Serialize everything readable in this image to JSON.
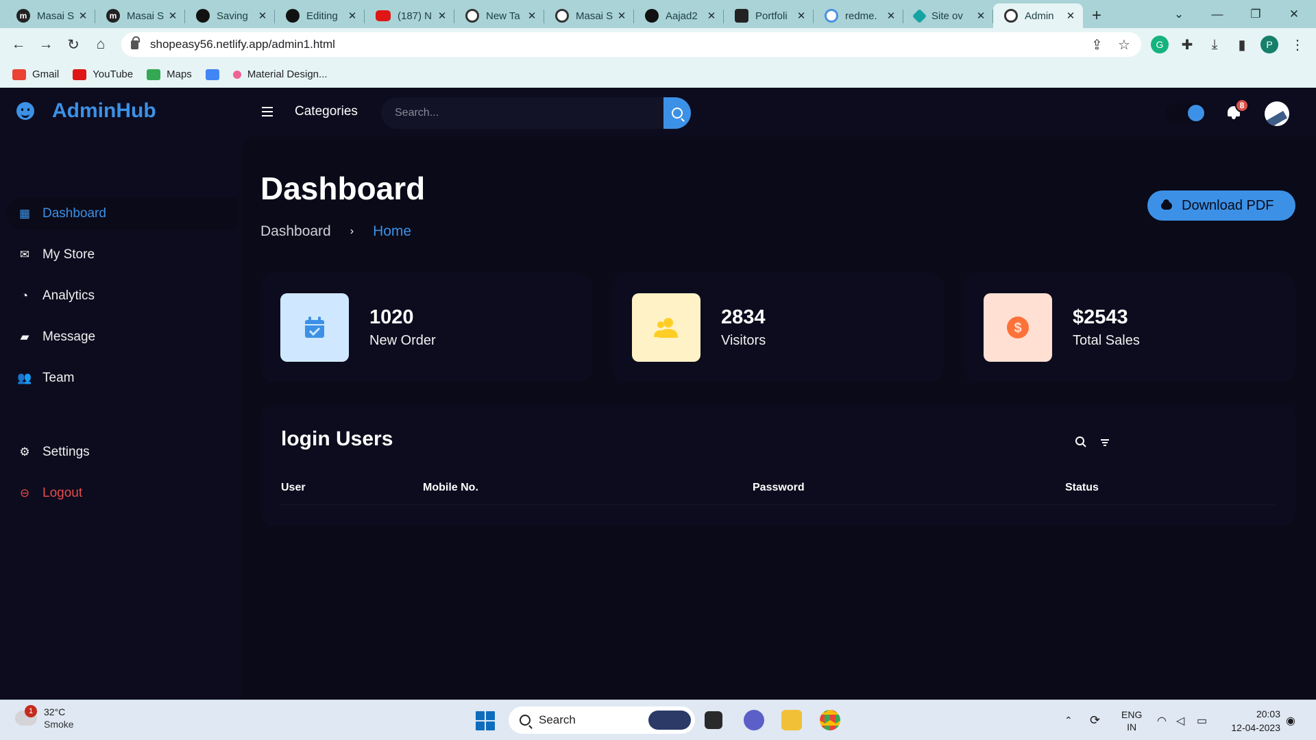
{
  "browser": {
    "tabs": [
      {
        "icon": "masai-favicon",
        "title": "Masai S",
        "active": false
      },
      {
        "icon": "masai-favicon",
        "title": "Masai S",
        "active": false
      },
      {
        "icon": "github-icon",
        "title": "Saving",
        "active": false
      },
      {
        "icon": "github-icon",
        "title": "Editing",
        "active": false
      },
      {
        "icon": "youtube-icon",
        "title": "(187) N",
        "active": false
      },
      {
        "icon": "chrome-icon",
        "title": "New Ta",
        "active": false
      },
      {
        "icon": "globe-icon",
        "title": "Masai S",
        "active": false
      },
      {
        "icon": "github-icon",
        "title": "Aajad2",
        "active": false
      },
      {
        "icon": "react-icon",
        "title": "Portfoli",
        "active": false
      },
      {
        "icon": "google-icon",
        "title": "redme.",
        "active": false
      },
      {
        "icon": "netlify-icon",
        "title": "Site ov",
        "active": false
      },
      {
        "icon": "globe-icon",
        "title": "Admin",
        "active": true
      }
    ],
    "new_tab_label": "+",
    "url": "shopeasy56.netlify.app/admin1.html",
    "profile_initial": "P",
    "bookmarks": [
      {
        "label": "Gmail",
        "color": "#ea4335"
      },
      {
        "label": "YouTube",
        "color": "#e01515"
      },
      {
        "label": "Maps",
        "color": "#34a853"
      },
      {
        "label": "",
        "color": "#4285f4"
      },
      {
        "label": "Material Design...",
        "color": "#f06292"
      }
    ]
  },
  "app": {
    "brand": "AdminHub",
    "menu": [
      {
        "label": "Dashboard",
        "icon": "dashboard-icon",
        "active": true
      },
      {
        "label": "My Store",
        "icon": "store-icon",
        "active": false
      },
      {
        "label": "Analytics",
        "icon": "analytics-icon",
        "active": false
      },
      {
        "label": "Message",
        "icon": "message-icon",
        "active": false
      },
      {
        "label": "Team",
        "icon": "team-icon",
        "active": false
      }
    ],
    "menu_bottom": [
      {
        "label": "Settings",
        "icon": "gear-icon"
      },
      {
        "label": "Logout",
        "icon": "logout-icon"
      }
    ],
    "topnav": {
      "categories": "Categories",
      "search_placeholder": "Search...",
      "notification_count": "8"
    },
    "page": {
      "title": "Dashboard",
      "breadcrumb": [
        "Dashboard",
        "Home"
      ],
      "download_label": "Download PDF"
    },
    "stats": [
      {
        "value": "1020",
        "label": "New Order",
        "icon": "calendar-check-icon",
        "color": "#3c91e6"
      },
      {
        "value": "2834",
        "label": "Visitors",
        "icon": "group-icon",
        "color": "#ffce26"
      },
      {
        "value": "$2543",
        "label": "Total Sales",
        "icon": "dollar-icon",
        "color": "#fd7238"
      }
    ],
    "table": {
      "title": "login Users",
      "columns": [
        "User",
        "Mobile No.",
        "Password",
        "Status"
      ],
      "rows": []
    }
  },
  "taskbar": {
    "weather_temp": "32°C",
    "weather_desc": "Smoke",
    "weather_alert": "1",
    "search_label": "Search",
    "lang_top": "ENG",
    "lang_bottom": "IN",
    "time": "20:03",
    "date": "12-04-2023"
  }
}
